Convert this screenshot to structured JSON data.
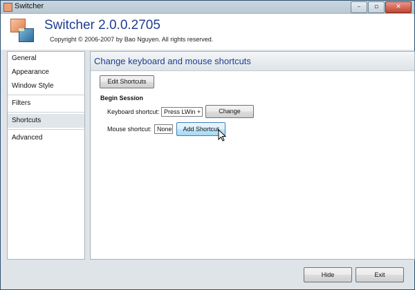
{
  "window": {
    "title": "Switcher",
    "controls": {
      "minimize": "–",
      "maximize": "▫",
      "close": "✕"
    }
  },
  "header": {
    "app_name": "Switcher 2.0.0.2705",
    "copyright": "Copyright © 2006-2007 by Bao Nguyen. All rights reserved."
  },
  "nav": {
    "items": [
      {
        "label": "General"
      },
      {
        "label": "Appearance"
      },
      {
        "label": "Window Style"
      },
      {
        "label": "Filters"
      },
      {
        "label": "Shortcuts",
        "selected": true
      },
      {
        "label": "Advanced"
      }
    ]
  },
  "content": {
    "title": "Change keyboard and mouse shortcuts",
    "edit_shortcuts_label": "Edit Shortcuts",
    "section_title": "Begin Session",
    "keyboard_label": "Keyboard shortcut:",
    "keyboard_value": "Press LWin + `",
    "change_label": "Change",
    "mouse_label": "Mouse shortcut:",
    "mouse_value": "None",
    "add_shortcut_label": "Add Shortcut"
  },
  "footer": {
    "hide_label": "Hide",
    "exit_label": "Exit"
  },
  "colors": {
    "accent_text": "#1e3c8f",
    "hover_button": "#bee6fd"
  }
}
